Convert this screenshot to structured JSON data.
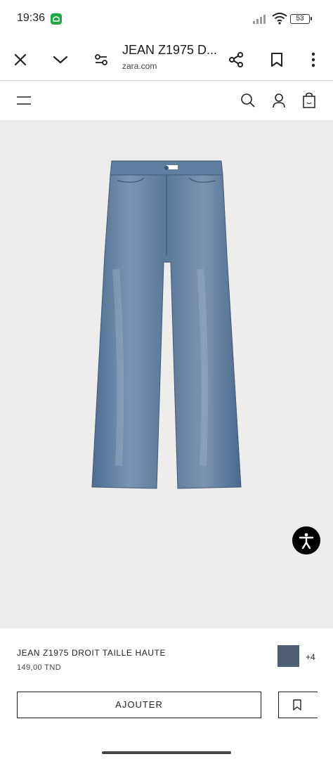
{
  "status_bar": {
    "time": "19:36",
    "battery": "53",
    "icons": [
      "notification-app-icon",
      "signal-icon",
      "wifi-icon",
      "battery-icon"
    ]
  },
  "browser": {
    "title": "JEAN Z1975 D...",
    "url": "zara.com",
    "icons": [
      "close-icon",
      "chevron-down-icon",
      "tune-icon",
      "share-icon",
      "bookmark-icon",
      "more-vert-icon"
    ]
  },
  "site_header": {
    "icons": [
      "menu-icon",
      "search-icon",
      "account-icon",
      "shopping-bag-icon"
    ]
  },
  "product": {
    "name": "JEAN Z1975 DROIT TAILLE HAUTE",
    "price": "149,00 TND",
    "swatch_color": "#4e5f74",
    "more_colors": "+4",
    "add_label": "AJOUTER",
    "image_alt_colors": {
      "denim": "#6f8aa8",
      "background": "#efedec"
    }
  },
  "accessibility": {
    "icon": "accessibility-icon"
  }
}
